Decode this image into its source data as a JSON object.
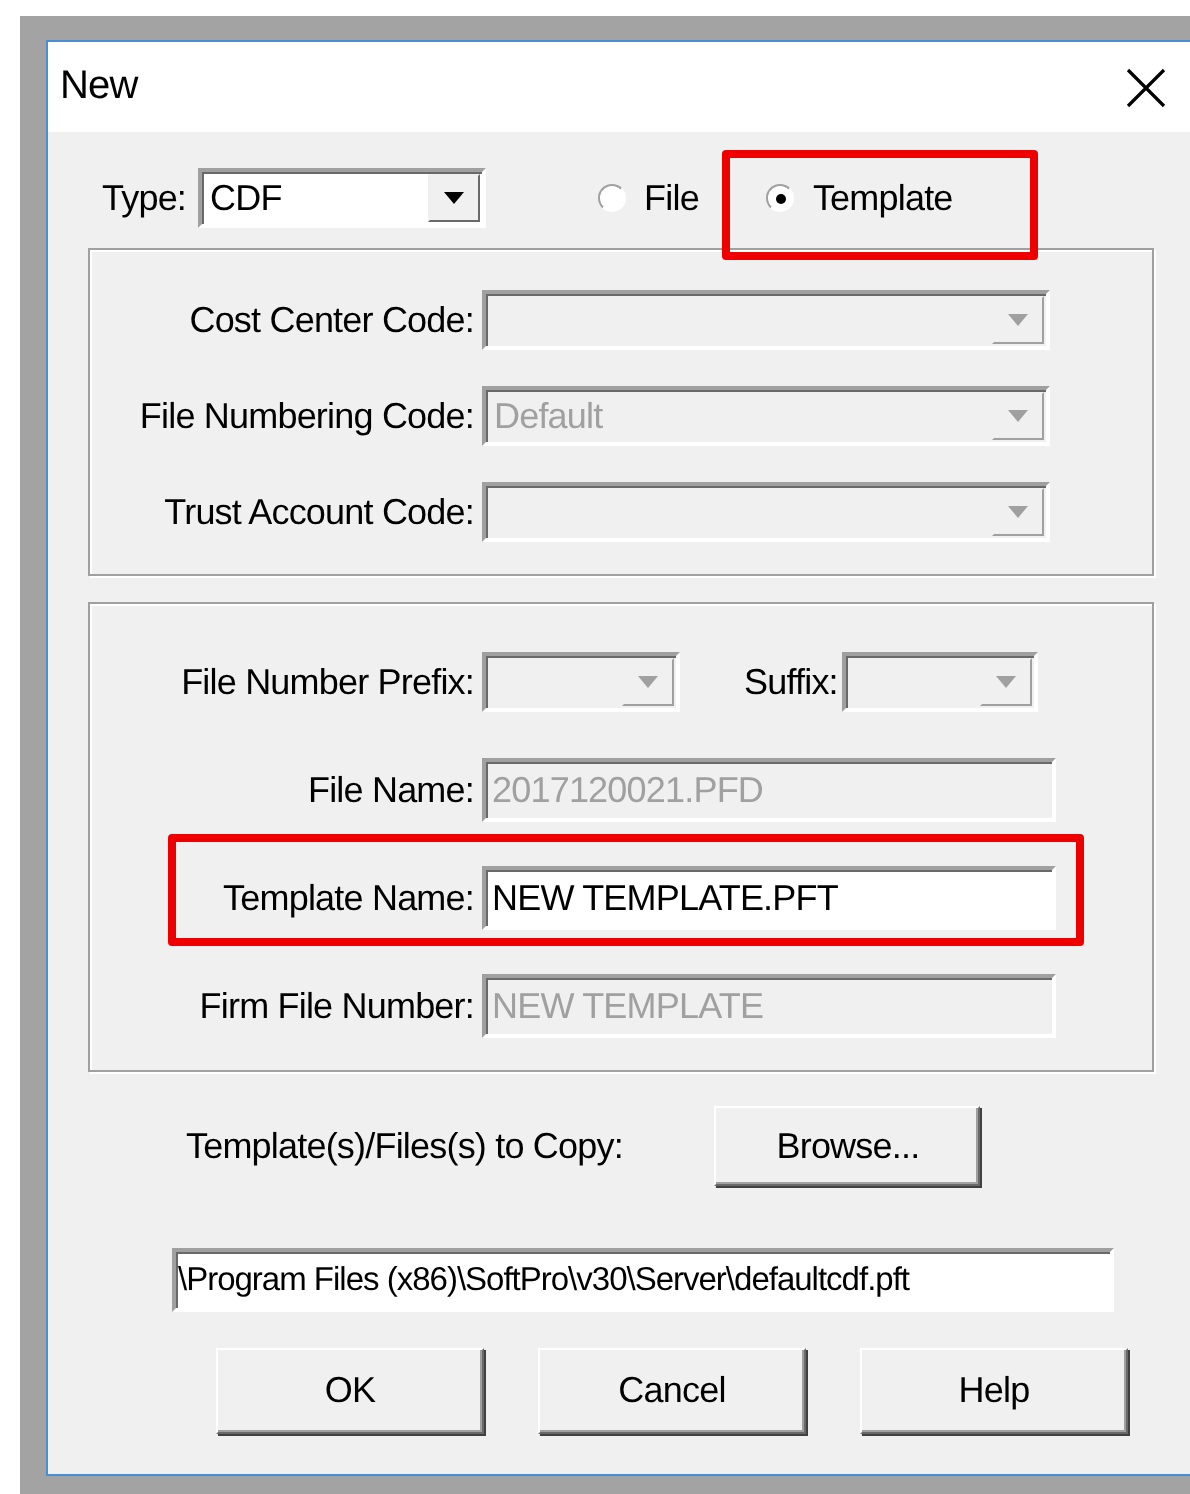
{
  "window": {
    "title": "New"
  },
  "type_field": {
    "label": "Type:",
    "value": "CDF",
    "disabled": false
  },
  "mode_options": [
    {
      "label": "File",
      "selected": false,
      "highlighted": false
    },
    {
      "label": "Template",
      "selected": true,
      "highlighted": true
    }
  ],
  "code_fields": [
    {
      "label": "Cost Center Code:",
      "disabled": true
    },
    {
      "label": "File Numbering Code:",
      "value": "Default",
      "disabled": true
    },
    {
      "label": "Trust Account Code:",
      "disabled": true
    }
  ],
  "number_fields": {
    "prefix": {
      "label": "File Number Prefix:",
      "disabled": true
    },
    "suffix": {
      "label": "Suffix:",
      "disabled": true
    }
  },
  "name_fields": [
    {
      "label": "File Name:",
      "value": "2017120021.PFD",
      "disabled": true,
      "highlighted": false
    },
    {
      "label": "Template Name:",
      "value": "NEW TEMPLATE.PFT",
      "disabled": false,
      "highlighted": true
    },
    {
      "label": "Firm File Number:",
      "value": "NEW TEMPLATE",
      "disabled": true,
      "highlighted": false
    }
  ],
  "copy": {
    "label": "Template(s)/Files(s) to Copy:",
    "browse_button": "Browse...",
    "path": "\\Program Files (x86)\\SoftPro\\v30\\Server\\defaultcdf.pft"
  },
  "buttons": [
    "OK",
    "Cancel",
    "Help"
  ]
}
